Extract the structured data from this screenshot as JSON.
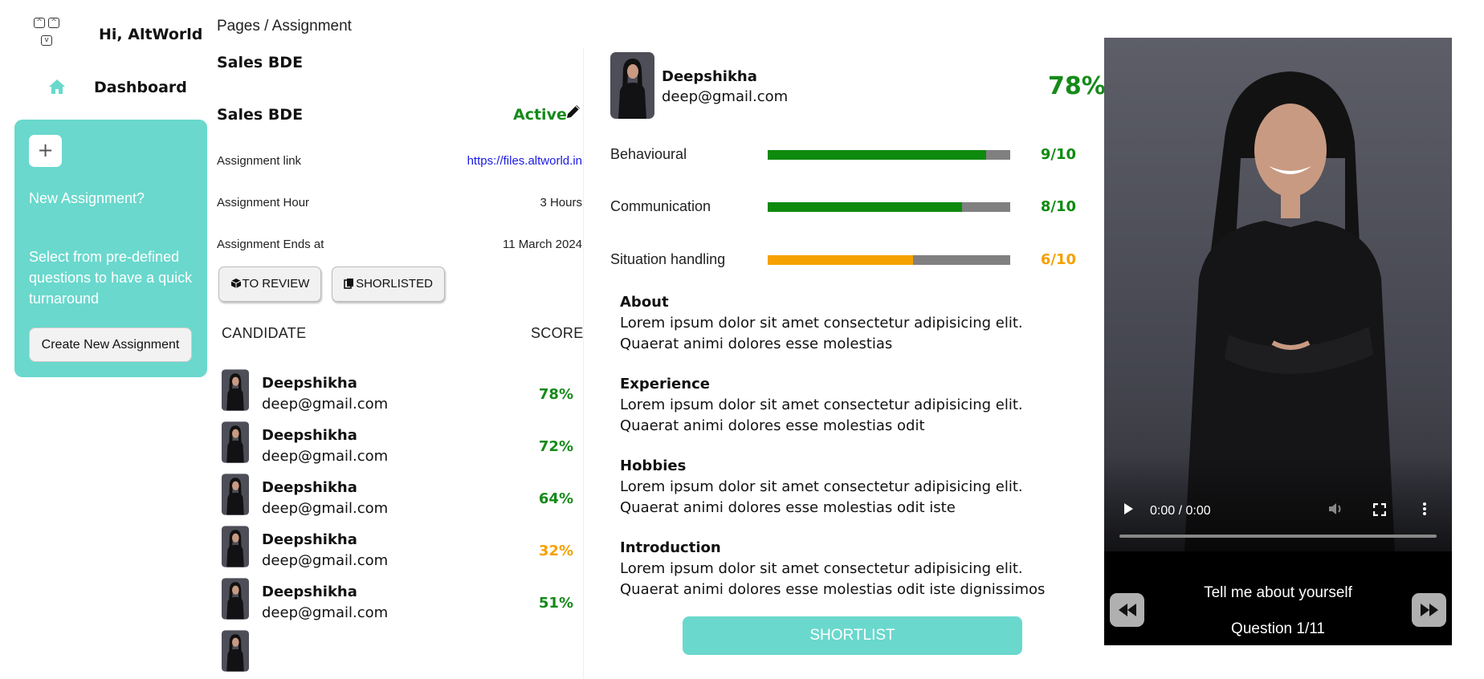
{
  "app": {
    "greeting": "Hi, AltWorld",
    "logo_keys": [
      "^",
      "^",
      "v"
    ]
  },
  "sidebar": {
    "items": [
      {
        "label": "Dashboard",
        "icon": "home-icon"
      }
    ],
    "promo": {
      "plus_label": "+",
      "title": "New Assignment?",
      "description": "Select from pre-defined questions to have a quick turnaround",
      "button_label": "Create New Assignment"
    }
  },
  "breadcrumb": "Pages / Assignment",
  "page_title": "Sales BDE",
  "assignment": {
    "name": "Sales BDE",
    "status": "Active",
    "info": [
      {
        "label": "Assignment link",
        "value": "https://files.altworld.in"
      },
      {
        "label": "Assignment Hour",
        "value": "3 Hours"
      },
      {
        "label": "Assignment Ends at",
        "value": "11 March 2024"
      }
    ]
  },
  "tabs": {
    "to_review": "TO REVIEW",
    "shortlisted": "SHORLISTED"
  },
  "table": {
    "col_candidate": "CANDIDATE",
    "col_score": "SCORE",
    "rows": [
      {
        "name": "Deepshikha",
        "email": "deep@gmail.com",
        "score": "78%",
        "color": "#168a1a"
      },
      {
        "name": "Deepshikha",
        "email": "deep@gmail.com",
        "score": "72%",
        "color": "#168a1a"
      },
      {
        "name": "Deepshikha",
        "email": "deep@gmail.com",
        "score": "64%",
        "color": "#168a1a"
      },
      {
        "name": "Deepshikha",
        "email": "deep@gmail.com",
        "score": "32%",
        "color": "#f5a100"
      },
      {
        "name": "Deepshikha",
        "email": "deep@gmail.com",
        "score": "51%",
        "color": "#168a1a"
      },
      {
        "name": "",
        "email": "",
        "score": "",
        "color": "#168a1a"
      }
    ]
  },
  "detail": {
    "name": "Deepshikha",
    "email": "deep@gmail.com",
    "score": "78%",
    "metrics": [
      {
        "label": "Behavioural",
        "value": "9/10",
        "fraction": 0.9,
        "color": "#0e8a0e"
      },
      {
        "label": "Communication",
        "value": "8/10",
        "fraction": 0.8,
        "color": "#0e8a0e"
      },
      {
        "label": "Situation handling",
        "value": "6/10",
        "fraction": 0.6,
        "color": "#f5a100"
      }
    ],
    "sections": [
      {
        "heading": "About",
        "text": "Lorem ipsum dolor sit amet consectetur adipisicing elit. Quaerat animi dolores esse molestias"
      },
      {
        "heading": "Experience",
        "text": "Lorem ipsum dolor sit amet consectetur adipisicing elit. Quaerat animi dolores esse molestias odit"
      },
      {
        "heading": "Hobbies",
        "text": "Lorem ipsum dolor sit amet consectetur adipisicing elit. Quaerat animi dolores esse molestias odit iste"
      },
      {
        "heading": "Introduction",
        "text": "Lorem ipsum dolor sit amet consectetur adipisicing elit. Quaerat animi dolores esse molestias odit iste dignissimos"
      }
    ],
    "shortlist_label": "SHORTLIST"
  },
  "video": {
    "time": "0:00 / 0:00",
    "progress": 0,
    "question": "Tell me about yourself",
    "counter": "Question 1/11"
  },
  "colors": {
    "accent": "#6ad8cd",
    "good": "#168a1a",
    "warn": "#f5a100"
  }
}
